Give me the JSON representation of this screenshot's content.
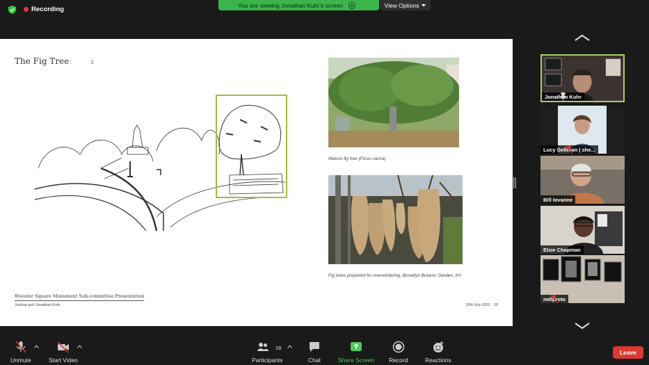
{
  "top": {
    "recording_label": "Recording",
    "viewing_banner": "You are viewing Jonathan Kuhr's screen",
    "view_options": "View Options"
  },
  "slide": {
    "title": "The Fig Tree",
    "page_marker": "3",
    "caption_top": "Mature fig tree (Ficus carica)",
    "caption_bottom": "Fig trees prepared for overwintering, Brooklyn Botanic Garden, NY",
    "footer_title": "Wooster Square Monument Sub-committee Presentation",
    "footer_authors": "Joshua and Jonathan Kuhr",
    "footer_date": "15th July 2021 · 20"
  },
  "participants": [
    {
      "name": "Jonathan Kuhr",
      "muted": false,
      "pinned": true,
      "active": true
    },
    {
      "name": "Lucy Gellman | she...",
      "muted": true,
      "pinned": false,
      "active": false
    },
    {
      "name": "Bill Iovanne",
      "muted": false,
      "pinned": false,
      "active": false
    },
    {
      "name": "Elsie Chapman",
      "muted": false,
      "pinned": false,
      "active": false
    },
    {
      "name": "nellproto",
      "muted": true,
      "pinned": false,
      "active": false
    }
  ],
  "toolbar": {
    "unmute": "Unmute",
    "start_video": "Start Video",
    "participants": "Participants",
    "participants_count": "18",
    "chat": "Chat",
    "share_screen": "Share Screen",
    "record": "Record",
    "reactions": "Reactions",
    "leave": "Leave"
  },
  "colors": {
    "accent_green": "#3bb54a",
    "active_speaker": "#a8d35a",
    "leave_red": "#d93b30",
    "recording_red": "#e53935"
  }
}
